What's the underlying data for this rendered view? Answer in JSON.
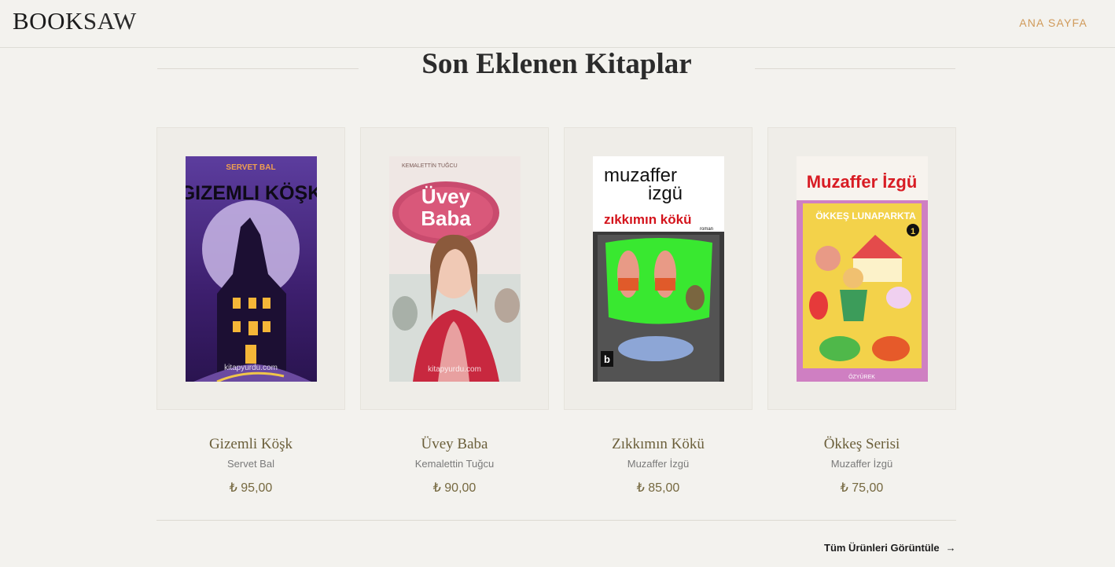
{
  "header": {
    "logo_bold": "BOOK",
    "logo_light": "SAW",
    "nav_home": "ANA SAYFA"
  },
  "section": {
    "title": "Son Eklenen Kitaplar"
  },
  "products": [
    {
      "title": "Gizemli Köşk",
      "author": "Servet Bal",
      "price": "₺ 95,00",
      "cover_top": "SERVET BAL",
      "cover_main": "GIZEMLI KÖŞK",
      "cover_site": "kitapyurdu.com"
    },
    {
      "title": "Üvey Baba",
      "author": "Kemalettin Tuğcu",
      "price": "₺ 90,00",
      "cover_top": "KEMALETTİN TUĞCU",
      "cover_main1": "Üvey",
      "cover_main2": "Baba",
      "cover_site": "kitapyurdu.com"
    },
    {
      "title": "Zıkkımın Kökü",
      "author": "Muzaffer İzgü",
      "price": "₺ 85,00",
      "cover_top1": "muzaffer",
      "cover_top2": "izgü",
      "cover_main": "zıkkımın kökü",
      "cover_sub": "roman",
      "cover_pub": "b"
    },
    {
      "title": "Ökkeş Serisi",
      "author": "Muzaffer İzgü",
      "price": "₺ 75,00",
      "cover_top": "Muzaffer İzgü",
      "cover_main": "ÖKKEŞ LUNAPARKTA",
      "cover_num": "1",
      "cover_pub": "ÖZYÜREK"
    }
  ],
  "footer": {
    "view_all": "Tüm Ürünleri Görüntüle",
    "arrow": "→"
  },
  "colors": {
    "background": "#f3f2ee",
    "accent": "#d09a5a",
    "title_text": "#6b5f3a"
  }
}
